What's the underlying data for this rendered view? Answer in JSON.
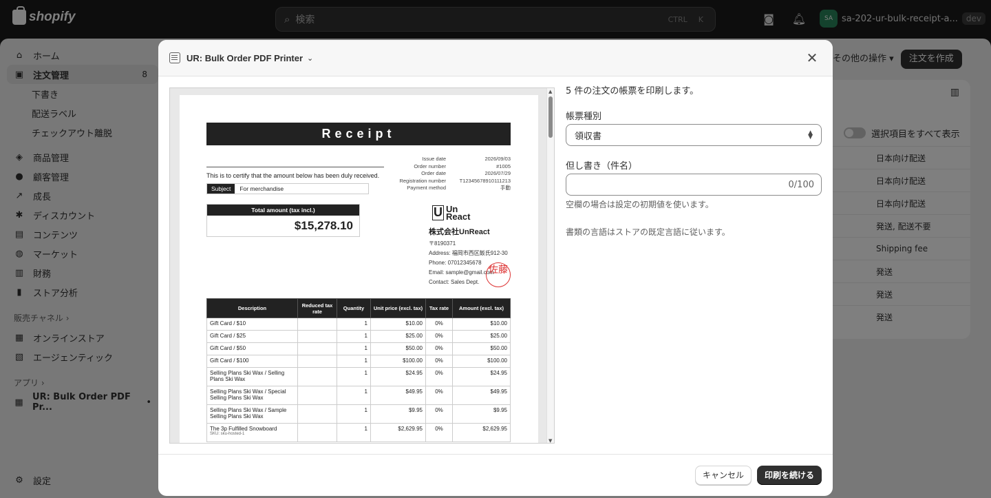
{
  "topbar": {
    "brand": "shopify",
    "search_placeholder": "検索",
    "shortcut_ctrl": "CTRL",
    "shortcut_k": "K",
    "store_avatar": "SA",
    "store_name": "sa-202-ur-bulk-receipt-a...",
    "env_badge": "dev"
  },
  "nav": {
    "items": [
      {
        "label": "ホーム",
        "icon": "home-icon"
      },
      {
        "label": "注文管理",
        "icon": "inbox-icon",
        "badge": "8"
      },
      {
        "label": "下書き"
      },
      {
        "label": "配送ラベル"
      },
      {
        "label": "チェックアウト離脱"
      },
      {
        "label": "商品管理",
        "icon": "tag-icon"
      },
      {
        "label": "顧客管理",
        "icon": "person-icon"
      },
      {
        "label": "成長",
        "icon": "chart-icon"
      },
      {
        "label": "ディスカウント",
        "icon": "discount-icon"
      },
      {
        "label": "コンテンツ",
        "icon": "content-icon"
      },
      {
        "label": "マーケット",
        "icon": "globe-icon"
      },
      {
        "label": "財務",
        "icon": "bank-icon"
      },
      {
        "label": "ストア分析",
        "icon": "analytics-icon"
      }
    ],
    "sales_channels_label": "販売チャネル",
    "channels": [
      {
        "label": "オンラインストア"
      },
      {
        "label": "エージェンティック"
      }
    ],
    "apps_label": "アプリ",
    "app_item": "UR: Bulk Order PDF Pr...",
    "settings": "設定"
  },
  "page": {
    "more_actions": "その他の操作",
    "create_order": "注文を作成",
    "show_all_label": "選択項目をすべて表示",
    "delivery_rows": [
      "日本向け配送",
      "日本向け配送",
      "日本向け配送",
      "発送, 配送不要",
      "Shipping fee",
      "発送",
      "発送",
      "発送"
    ]
  },
  "modal": {
    "title": "UR: Bulk Order PDF Printer",
    "count_text": "5 件の注文の帳票を印刷します。",
    "doc_type_label": "帳票種別",
    "doc_type_value": "領収書",
    "subject_label": "但し書き（件名）",
    "subject_value": "",
    "subject_counter": "0/100",
    "subject_help": "空欄の場合は設定の初期値を使います。",
    "language_note": "書類の言語はストアの既定言語に従います。",
    "cancel_label": "キャンセル",
    "continue_label": "印刷を続ける"
  },
  "receipt": {
    "title": "Receipt",
    "certify": "This is to certify that the amount below has been duly received.",
    "subject_key": "Subject",
    "subject_value": "For merchandise",
    "meta": [
      {
        "k": "Issue date",
        "v": "2026/09/03"
      },
      {
        "k": "Order number",
        "v": "#1005"
      },
      {
        "k": "Order date",
        "v": "2026/07/29"
      },
      {
        "k": "Registration number",
        "v": "T12345678910111213"
      },
      {
        "k": "Payment method",
        "v": "手動"
      }
    ],
    "total_label": "Total amount (tax incl.)",
    "total_value": "$15,278.10",
    "logo_top": "Un",
    "logo_bottom": "React",
    "company": "株式会社UnReact",
    "postal": "〒8190371",
    "address": "Address: 福岡市西区飯氏912-30",
    "phone": "Phone: 07012345678",
    "email": "Email: sample@gmail.com",
    "contact": "Contact: Sales Dept.",
    "stamp": "佐藤",
    "columns": [
      "Description",
      "Reduced tax rate",
      "Quantity",
      "Unit price (excl. tax)",
      "Tax rate",
      "Amount (excl. tax)"
    ],
    "rows": [
      {
        "desc": "Gift Card / $10",
        "qty": "1",
        "unit": "$10.00",
        "rate": "0%",
        "amount": "$10.00"
      },
      {
        "desc": "Gift Card / $25",
        "qty": "1",
        "unit": "$25.00",
        "rate": "0%",
        "amount": "$25.00"
      },
      {
        "desc": "Gift Card / $50",
        "qty": "1",
        "unit": "$50.00",
        "rate": "0%",
        "amount": "$50.00"
      },
      {
        "desc": "Gift Card / $100",
        "qty": "1",
        "unit": "$100.00",
        "rate": "0%",
        "amount": "$100.00"
      },
      {
        "desc": "Selling Plans Ski Wax / Selling Plans Ski Wax",
        "qty": "1",
        "unit": "$24.95",
        "rate": "0%",
        "amount": "$24.95"
      },
      {
        "desc": "Selling Plans Ski Wax / Special Selling Plans Ski Wax",
        "qty": "1",
        "unit": "$49.95",
        "rate": "0%",
        "amount": "$49.95"
      },
      {
        "desc": "Selling Plans Ski Wax / Sample Selling Plans Ski Wax",
        "qty": "1",
        "unit": "$9.95",
        "rate": "0%",
        "amount": "$9.95"
      },
      {
        "desc": "The 3p Fulfilled Snowboard",
        "sku": "SKU: sku-hosted-1",
        "qty": "1",
        "unit": "$2,629.95",
        "rate": "0%",
        "amount": "$2,629.95"
      }
    ]
  }
}
